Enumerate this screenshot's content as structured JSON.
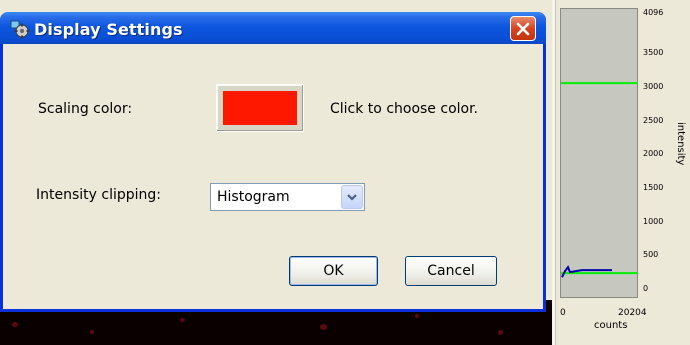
{
  "dialog": {
    "title": "Display Settings",
    "title_icon": "gear-app-icon",
    "close_icon": "close-icon",
    "scaling_color_label": "Scaling color:",
    "scaling_color_value": "#ff1800",
    "choose_color_hint": "Click to choose color.",
    "intensity_clipping_label": "Intensity clipping:",
    "intensity_clipping_selected": "Histogram",
    "ok_label": "OK",
    "cancel_label": "Cancel"
  },
  "histogram": {
    "y_axis_title": "intensity",
    "x_axis_title": "counts",
    "y_ticks": [
      "4096",
      "3500",
      "3000",
      "2500",
      "2000",
      "1500",
      "1000",
      "500",
      "0"
    ],
    "x_ticks": [
      "0",
      "20204"
    ],
    "upper_clip_level": 3070,
    "lower_clip_level": 250,
    "clip_line_color": "#00ee00",
    "histogram_color": "#0000aa"
  }
}
